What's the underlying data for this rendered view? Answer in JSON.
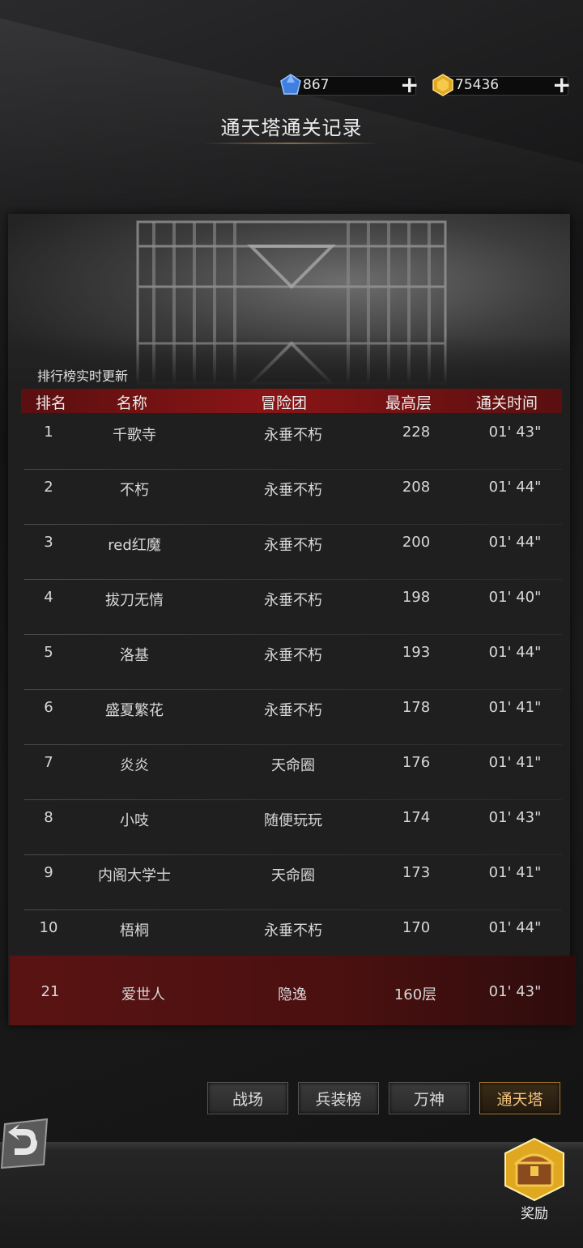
{
  "currencies": [
    {
      "icon": "blue-gem-icon",
      "value": "867",
      "color": "#3f7fe0"
    },
    {
      "icon": "gold-coin-icon",
      "value": "75436",
      "color": "#e0a820"
    }
  ],
  "title": "通天塔通关记录",
  "banner_note": "排行榜实时更新",
  "columns": [
    "排名",
    "名称",
    "冒险团",
    "最高层",
    "通关时间"
  ],
  "rows": [
    {
      "rank": "1",
      "name": "千歌寺",
      "guild": "永垂不朽",
      "floor": "228",
      "time": "01' 43\""
    },
    {
      "rank": "2",
      "name": "不朽",
      "guild": "永垂不朽",
      "floor": "208",
      "time": "01' 44\""
    },
    {
      "rank": "3",
      "name": "red红魔",
      "guild": "永垂不朽",
      "floor": "200",
      "time": "01' 44\""
    },
    {
      "rank": "4",
      "name": "拔刀无情",
      "guild": "永垂不朽",
      "floor": "198",
      "time": "01' 40\""
    },
    {
      "rank": "5",
      "name": "洛基",
      "guild": "永垂不朽",
      "floor": "193",
      "time": "01' 44\""
    },
    {
      "rank": "6",
      "name": "盛夏繁花",
      "guild": "永垂不朽",
      "floor": "178",
      "time": "01' 41\""
    },
    {
      "rank": "7",
      "name": "炎炎",
      "guild": "天命圈",
      "floor": "176",
      "time": "01' 41\""
    },
    {
      "rank": "8",
      "name": "小吱",
      "guild": "随便玩玩",
      "floor": "174",
      "time": "01' 43\""
    },
    {
      "rank": "9",
      "name": "内阁大学士",
      "guild": "天命圈",
      "floor": "173",
      "time": "01' 41\""
    },
    {
      "rank": "10",
      "name": "梧桐",
      "guild": "永垂不朽",
      "floor": "170",
      "time": "01' 44\""
    }
  ],
  "self_row": {
    "rank": "21",
    "name": "爱世人",
    "guild": "隐逸",
    "floor": "160层",
    "time": "01' 43\""
  },
  "tabs": [
    {
      "label": "战场",
      "active": false
    },
    {
      "label": "兵装榜",
      "active": false
    },
    {
      "label": "万神",
      "active": false
    },
    {
      "label": "通天塔",
      "active": true
    }
  ],
  "reward_label": "奖励",
  "accent_red": "#8a1516",
  "accent_gold": "#a8782c"
}
